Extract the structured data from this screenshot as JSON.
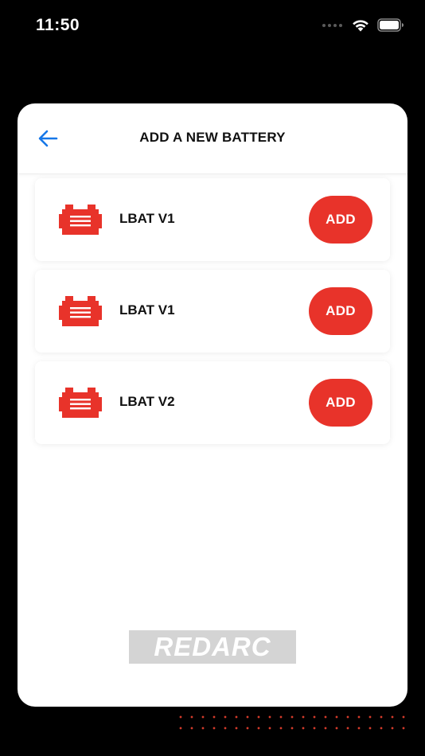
{
  "status_bar": {
    "time": "11:50",
    "icons": [
      "cellular-signal-icon",
      "wifi-icon",
      "battery-icon"
    ]
  },
  "header": {
    "back_icon": "arrow-left-icon",
    "title": "ADD A NEW BATTERY"
  },
  "batteries": [
    {
      "name": "LBAT V1",
      "button_label": "ADD",
      "icon": "battery-icon"
    },
    {
      "name": "LBAT V1",
      "button_label": "ADD",
      "icon": "battery-icon"
    },
    {
      "name": "LBAT V2",
      "button_label": "ADD",
      "icon": "battery-icon"
    }
  ],
  "brand": {
    "logo_text": "REDARC"
  },
  "colors": {
    "accent": "#e8332a",
    "back_arrow": "#1677e8",
    "background": "#000000",
    "card": "#ffffff",
    "logo_bg": "#d4d4d4"
  }
}
